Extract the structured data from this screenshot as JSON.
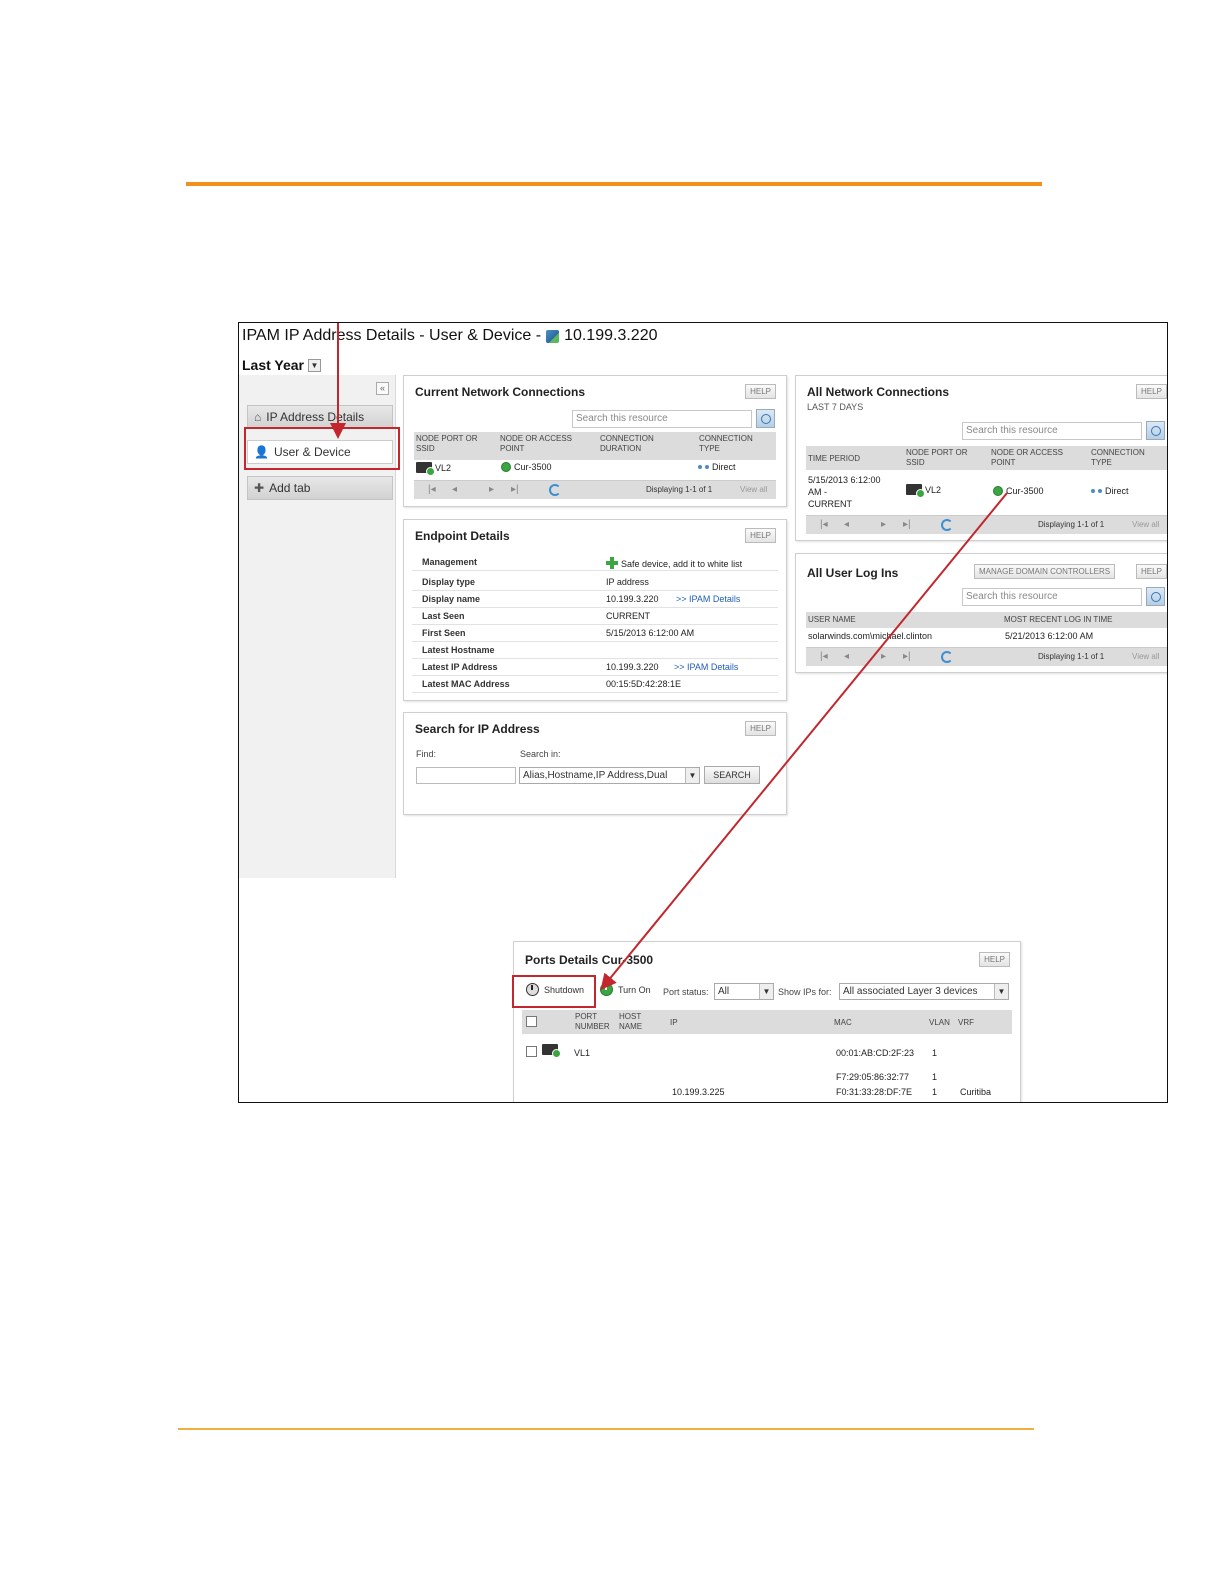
{
  "page": {
    "title": "IPAM IP Address Details - User & Device -",
    "ip": "10.199.3.220",
    "period": "Last Year",
    "collapse_glyph": "«"
  },
  "sidebar": {
    "tabs": [
      {
        "label": "IP Address Details",
        "icon": "home-icon"
      },
      {
        "label": "User & Device",
        "icon": "user-device-icon"
      },
      {
        "label": "Add tab",
        "icon": "plus-icon"
      }
    ]
  },
  "help_label": "HELP",
  "search_placeholder": "Search this resource",
  "current_connections": {
    "title": "Current Network Connections",
    "headers": [
      "NODE PORT OR SSID",
      "NODE OR ACCESS POINT",
      "CONNECTION DURATION",
      "CONNECTION TYPE"
    ],
    "row": {
      "port": "VL2",
      "node": "Cur-3500",
      "duration": "",
      "type": "Direct"
    },
    "pager_info": "Displaying 1-1 of 1",
    "view_all": "View all"
  },
  "endpoint": {
    "title": "Endpoint Details",
    "rows": [
      {
        "key": "Management",
        "value": "Safe device, add it to white list"
      },
      {
        "key": "Display type",
        "value": "IP address"
      },
      {
        "key": "Display name",
        "value": "10.199.3.220",
        "link": ">> IPAM Details"
      },
      {
        "key": "Last Seen",
        "value": "CURRENT"
      },
      {
        "key": "First Seen",
        "value": "5/15/2013 6:12:00 AM"
      },
      {
        "key": "Latest Hostname",
        "value": ""
      },
      {
        "key": "Latest IP Address",
        "value": "10.199.3.220",
        "link": ">> IPAM Details"
      },
      {
        "key": "Latest MAC Address",
        "value": "00:15:5D:42:28:1E"
      }
    ]
  },
  "search_ip": {
    "title": "Search for IP Address",
    "find_label": "Find:",
    "search_in_label": "Search in:",
    "search_in_value": "Alias,Hostname,IP Address,Dual",
    "button": "SEARCH"
  },
  "all_connections": {
    "title": "All Network Connections",
    "subtitle": "LAST 7 DAYS",
    "headers": [
      "TIME PERIOD",
      "NODE PORT OR SSID",
      "NODE OR ACCESS POINT",
      "CONNECTION TYPE"
    ],
    "row": {
      "period_1": "5/15/2013 6:12:00",
      "period_2": "AM -",
      "period_3": "CURRENT",
      "port": "VL2",
      "node": "Cur-3500",
      "type": "Direct"
    },
    "pager_info": "Displaying 1-1 of 1",
    "view_all": "View all"
  },
  "user_logins": {
    "title": "All User Log Ins",
    "manage_button": "MANAGE DOMAIN CONTROLLERS",
    "headers": [
      "USER NAME",
      "MOST RECENT LOG IN TIME"
    ],
    "row": {
      "user": "solarwinds.com\\michael.clinton",
      "time": "5/21/2013 6:12:00 AM"
    },
    "pager_info": "Displaying 1-1 of 1",
    "view_all": "View all"
  },
  "ports": {
    "title": "Ports Details Cur-3500",
    "shutdown": "Shutdown",
    "turn_on": "Turn On",
    "port_status_label": "Port status:",
    "port_status_value": "All",
    "show_ips_label": "Show IPs for:",
    "show_ips_value": "All associated Layer 3 devices",
    "headers": [
      "PORT NUMBER",
      "HOST NAME",
      "IP",
      "MAC",
      "VLAN",
      "VRF"
    ],
    "rows": [
      {
        "port": "VL1",
        "host": "",
        "ip": "",
        "mac": "00:01:AB:CD:2F:23",
        "vlan": "1",
        "vrf": ""
      },
      {
        "port": "",
        "host": "",
        "ip": "",
        "mac": "F7:29:05:86:32:77",
        "vlan": "1",
        "vrf": ""
      },
      {
        "port": "",
        "host": "",
        "ip": "10.199.3.225",
        "mac": "F0:31:33:28:DF:7E",
        "vlan": "1",
        "vrf": "Curitiba"
      }
    ]
  },
  "colors": {
    "accent_rule": "#f0901e",
    "highlight": "#c1272d",
    "link": "#1f5fb8",
    "status_green": "#3aa541"
  }
}
